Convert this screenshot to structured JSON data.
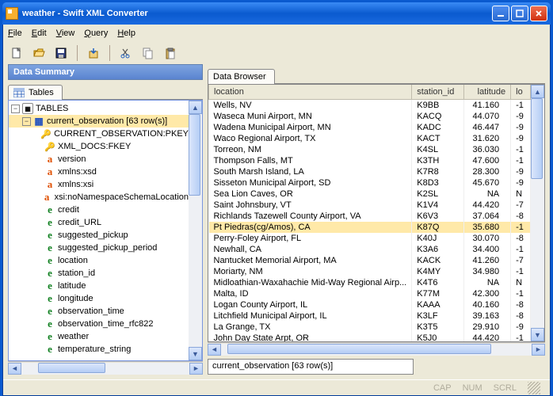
{
  "window": {
    "title": "weather - Swift XML Converter"
  },
  "menu": {
    "file": "File",
    "edit": "Edit",
    "view": "View",
    "query": "Query",
    "help": "Help"
  },
  "left_panel": {
    "title": "Data Summary",
    "tab": "Tables",
    "root": "TABLES",
    "table_node": "current_observation [63 row(s)]",
    "fields": [
      {
        "icon": "key",
        "label": "CURRENT_OBSERVATION:PKEY"
      },
      {
        "icon": "key",
        "label": "XML_DOCS:FKEY"
      },
      {
        "icon": "a",
        "label": "version"
      },
      {
        "icon": "a",
        "label": "xmlns:xsd"
      },
      {
        "icon": "a",
        "label": "xmlns:xsi"
      },
      {
        "icon": "a",
        "label": "xsi:noNamespaceSchemaLocation"
      },
      {
        "icon": "e",
        "label": "credit"
      },
      {
        "icon": "e",
        "label": "credit_URL"
      },
      {
        "icon": "e",
        "label": "suggested_pickup"
      },
      {
        "icon": "e",
        "label": "suggested_pickup_period"
      },
      {
        "icon": "e",
        "label": "location"
      },
      {
        "icon": "e",
        "label": "station_id"
      },
      {
        "icon": "e",
        "label": "latitude"
      },
      {
        "icon": "e",
        "label": "longitude"
      },
      {
        "icon": "e",
        "label": "observation_time"
      },
      {
        "icon": "e",
        "label": "observation_time_rfc822"
      },
      {
        "icon": "e",
        "label": "weather"
      },
      {
        "icon": "e",
        "label": "temperature_string"
      }
    ]
  },
  "right_panel": {
    "tab": "Data Browser",
    "columns": {
      "location": "location",
      "station_id": "station_id",
      "latitude": "latitude",
      "longitude": "lo"
    },
    "rows": [
      {
        "location": "Wells, NV",
        "station_id": "K9BB",
        "latitude": "41.160",
        "lon": "-1"
      },
      {
        "location": "Waseca Muni Airport, MN",
        "station_id": "KACQ",
        "latitude": "44.070",
        "lon": "-9"
      },
      {
        "location": "Wadena Municipal Airport, MN",
        "station_id": "KADC",
        "latitude": "46.447",
        "lon": "-9"
      },
      {
        "location": "Waco Regional Airport, TX",
        "station_id": "KACT",
        "latitude": "31.620",
        "lon": "-9"
      },
      {
        "location": "Torreon, NM",
        "station_id": "K4SL",
        "latitude": "36.030",
        "lon": "-1"
      },
      {
        "location": "Thompson Falls, MT",
        "station_id": "K3TH",
        "latitude": "47.600",
        "lon": "-1"
      },
      {
        "location": "South Marsh Island, LA",
        "station_id": "K7R8",
        "latitude": "28.300",
        "lon": "-9"
      },
      {
        "location": "Sisseton Municipal Airport, SD",
        "station_id": "K8D3",
        "latitude": "45.670",
        "lon": "-9"
      },
      {
        "location": "Sea Lion Caves, OR",
        "station_id": "K2SL",
        "latitude": "NA",
        "lon": "N"
      },
      {
        "location": "Saint Johnsbury, VT",
        "station_id": "K1V4",
        "latitude": "44.420",
        "lon": "-7"
      },
      {
        "location": "Richlands Tazewell County Airport, VA",
        "station_id": "K6V3",
        "latitude": "37.064",
        "lon": "-8"
      },
      {
        "location": "Pt Piedras(cg/Amos), CA",
        "station_id": "K87Q",
        "latitude": "35.680",
        "lon": "-1",
        "selected": true
      },
      {
        "location": "Perry-Foley Airport, FL",
        "station_id": "K40J",
        "latitude": "30.070",
        "lon": "-8"
      },
      {
        "location": "Newhall, CA",
        "station_id": "K3A6",
        "latitude": "34.400",
        "lon": "-1"
      },
      {
        "location": "Nantucket Memorial Airport, MA",
        "station_id": "KACK",
        "latitude": "41.260",
        "lon": "-7"
      },
      {
        "location": "Moriarty, NM",
        "station_id": "K4MY",
        "latitude": "34.980",
        "lon": "-1"
      },
      {
        "location": "Midloathian-Waxahachie Mid-Way Regional Airp...",
        "station_id": "K4T6",
        "latitude": "NA",
        "lon": "N"
      },
      {
        "location": "Malta, ID",
        "station_id": "K77M",
        "latitude": "42.300",
        "lon": "-1"
      },
      {
        "location": "Logan County Airport, IL",
        "station_id": "KAAA",
        "latitude": "40.160",
        "lon": "-8"
      },
      {
        "location": "Litchfield Municipal Airport, IL",
        "station_id": "K3LF",
        "latitude": "39.163",
        "lon": "-8"
      },
      {
        "location": "La Grange, TX",
        "station_id": "K3T5",
        "latitude": "29.910",
        "lon": "-9"
      },
      {
        "location": "John Day State Arpt, OR",
        "station_id": "K5J0",
        "latitude": "44.420",
        "lon": "-1"
      }
    ],
    "status": "current_observation [63 row(s)]"
  },
  "statusbar": {
    "cap": "CAP",
    "num": "NUM",
    "scrl": "SCRL"
  }
}
